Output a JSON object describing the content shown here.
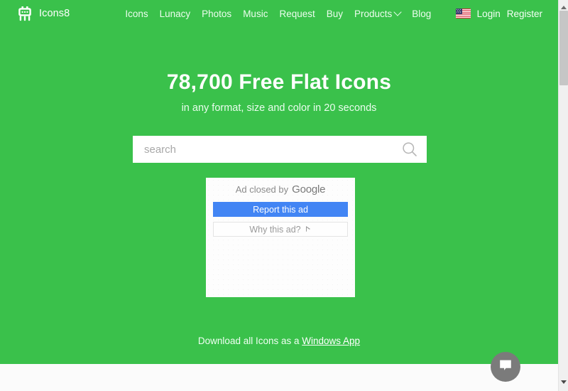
{
  "theme": {
    "brand_green": "#3ac14b",
    "google_blue": "#4285f4",
    "white": "#ffffff",
    "chat_gray": "#7b7b7b"
  },
  "header": {
    "brand_name": "Icons8",
    "logo_icon": "icons8-robot-chip-icon",
    "nav": [
      {
        "label": "Icons",
        "has_chevron": false
      },
      {
        "label": "Lunacy",
        "has_chevron": false
      },
      {
        "label": "Photos",
        "has_chevron": false
      },
      {
        "label": "Music",
        "has_chevron": false
      },
      {
        "label": "Request",
        "has_chevron": false
      },
      {
        "label": "Buy",
        "has_chevron": false
      },
      {
        "label": "Products",
        "has_chevron": true
      },
      {
        "label": "Blog",
        "has_chevron": false
      }
    ],
    "language_flag": "us-flag-icon",
    "login_label": "Login",
    "register_label": "Register"
  },
  "hero": {
    "headline": "78,700 Free Flat Icons",
    "subhead": "in any format, size and color in 20 seconds"
  },
  "search": {
    "value": "",
    "placeholder": "search",
    "icon": "search-icon"
  },
  "ad": {
    "closed_prefix": "Ad closed by",
    "provider": "Google",
    "report_label": "Report this ad",
    "why_label": "Why this ad?",
    "adchoices_icon": "adchoices-triangle-icon"
  },
  "footer": {
    "download_text": "Download all Icons as a ",
    "download_link_label": "Windows App"
  },
  "chat": {
    "icon": "chat-bubble-icon",
    "label": "Open chat"
  },
  "scrollbar": {
    "up_icon": "scroll-up-arrow-icon",
    "down_icon": "scroll-down-arrow-icon",
    "thumb": "scrollbar-thumb"
  }
}
